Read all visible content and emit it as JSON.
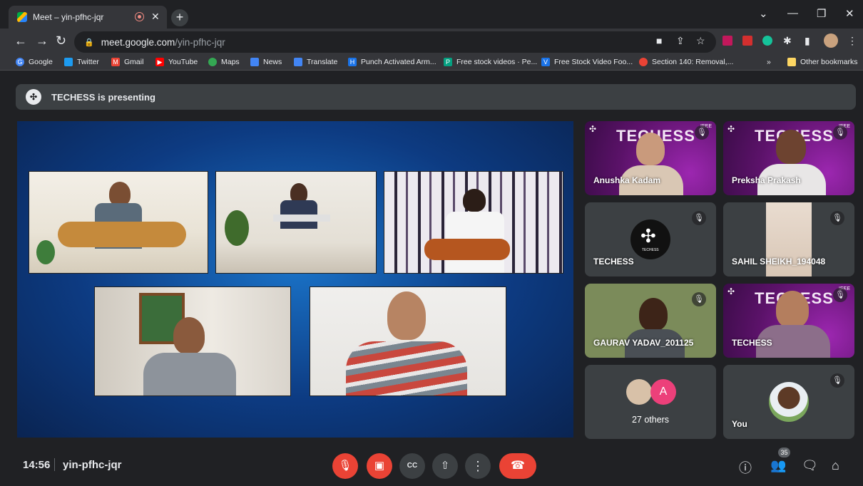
{
  "browser": {
    "tab_title": "Meet – yin-pfhc-jqr",
    "new_tab_label": "+",
    "url_host": "meet.google.com",
    "url_path": "/yin-pfhc-jqr",
    "bookmarks": [
      {
        "label": "Google",
        "icon": "google-icon",
        "color": "#4285f4"
      },
      {
        "label": "Twitter",
        "icon": "twitter-icon",
        "color": "#1d9bf0"
      },
      {
        "label": "Gmail",
        "icon": "gmail-icon",
        "color": "#ea4335"
      },
      {
        "label": "YouTube",
        "icon": "youtube-icon",
        "color": "#ff0000"
      },
      {
        "label": "Maps",
        "icon": "maps-icon",
        "color": "#34a853"
      },
      {
        "label": "News",
        "icon": "news-icon",
        "color": "#4285f4"
      },
      {
        "label": "Translate",
        "icon": "translate-icon",
        "color": "#4285f4"
      },
      {
        "label": "Punch Activated Arm...",
        "icon": "bookmark-icon",
        "color": "#1a73e8"
      },
      {
        "label": "Free stock videos · Pe...",
        "icon": "bookmark-icon",
        "color": "#05a081"
      },
      {
        "label": "Free Stock Video Foo...",
        "icon": "bookmark-icon",
        "color": "#1a73e8"
      },
      {
        "label": "Section 140: Removal,...",
        "icon": "bookmark-icon",
        "color": "#ea4335"
      }
    ],
    "overflow_label": "»",
    "other_bookmarks": "Other bookmarks"
  },
  "banner": {
    "text": "TECHESS is presenting"
  },
  "tiles": [
    {
      "name": "Anushka Kadam",
      "muted": true,
      "logo": "TECHESS"
    },
    {
      "name": "Preksha Prakash",
      "muted": true,
      "logo": "TECHESS"
    },
    {
      "name": "TECHESS",
      "muted": true
    },
    {
      "name": "SAHIL SHEIKH_194048",
      "muted": true
    },
    {
      "name": "GAURAV YADAV_201125",
      "muted": true
    },
    {
      "name": "TECHESS",
      "muted": true,
      "logo": "TECHESS"
    },
    {
      "name": "27 others",
      "avatar_letter": "A"
    },
    {
      "name": "You",
      "muted": true
    }
  ],
  "tile_brand_small": "TECHESS",
  "ieee_label": "IEEE",
  "bottom": {
    "time": "14:56",
    "meeting_code": "yin-pfhc-jqr",
    "participant_count": "35"
  },
  "colors": {
    "accent_red": "#ea4335",
    "bar_bg": "#202124",
    "tile_bg": "#3c4043",
    "purple": "#5b1269"
  }
}
